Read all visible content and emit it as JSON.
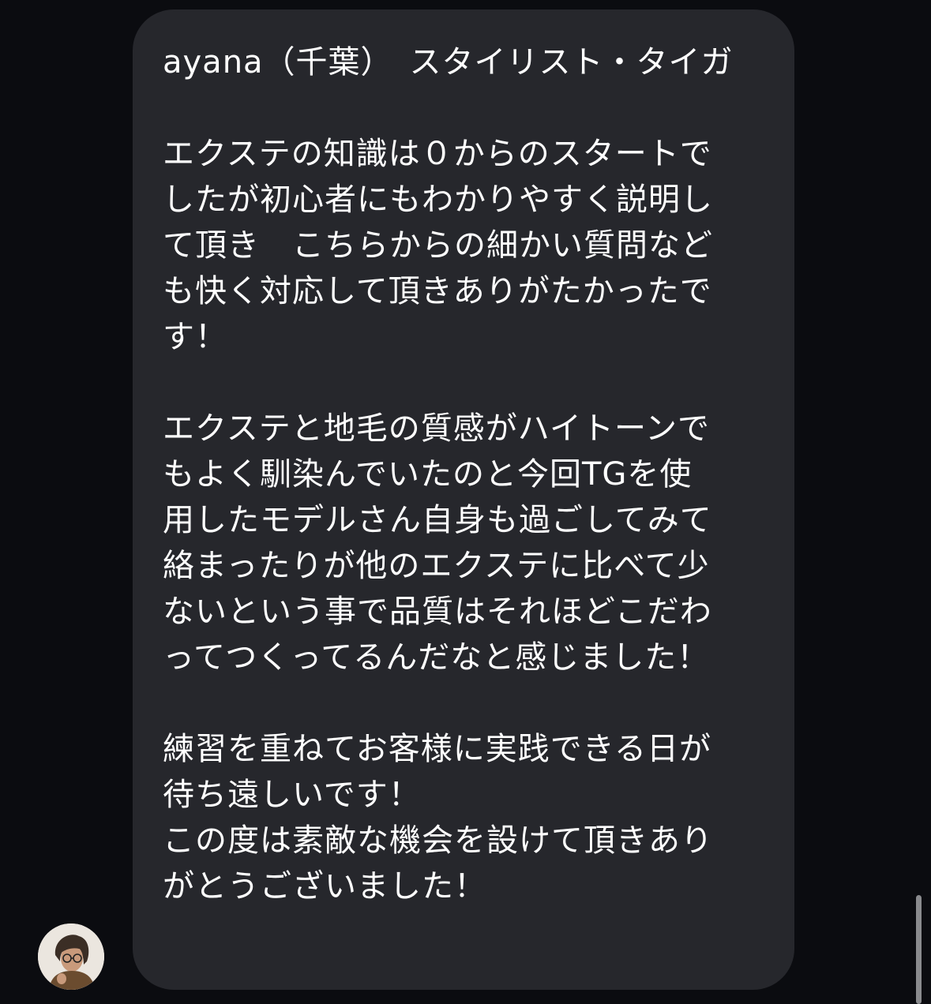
{
  "chat": {
    "message": {
      "sender_line": "ayana（千葉）　スタイリスト・タイガ",
      "paragraph1": [
        "エクステの知識は０からのスタートで",
        "したが初心者にもわかりやすく説明し",
        "て頂き　こちらからの細かい質問など",
        "も快く対応して頂きありがたかったで",
        "す！"
      ],
      "paragraph2": [
        "エクステと地毛の質感がハイトーンで",
        "もよく馴染んでいたのと今回TGを使",
        "用したモデルさん自身も過ごしてみて",
        "絡まったりが他のエクステに比べて少",
        "ないという事で品質はそれほどこだわ",
        "ってつくってるんだなと感じました！"
      ],
      "paragraph3": [
        "練習を重ねてお客様に実践できる日が",
        "待ち遠しいです！",
        "この度は素敵な機会を設けて頂きあり",
        "がとうございました！"
      ]
    },
    "avatar": {
      "icon": "person-photo"
    }
  },
  "colors": {
    "background": "#0b0c10",
    "bubble": "#26272c",
    "text": "#ffffff",
    "scrollbar": "#8a8b8e"
  }
}
